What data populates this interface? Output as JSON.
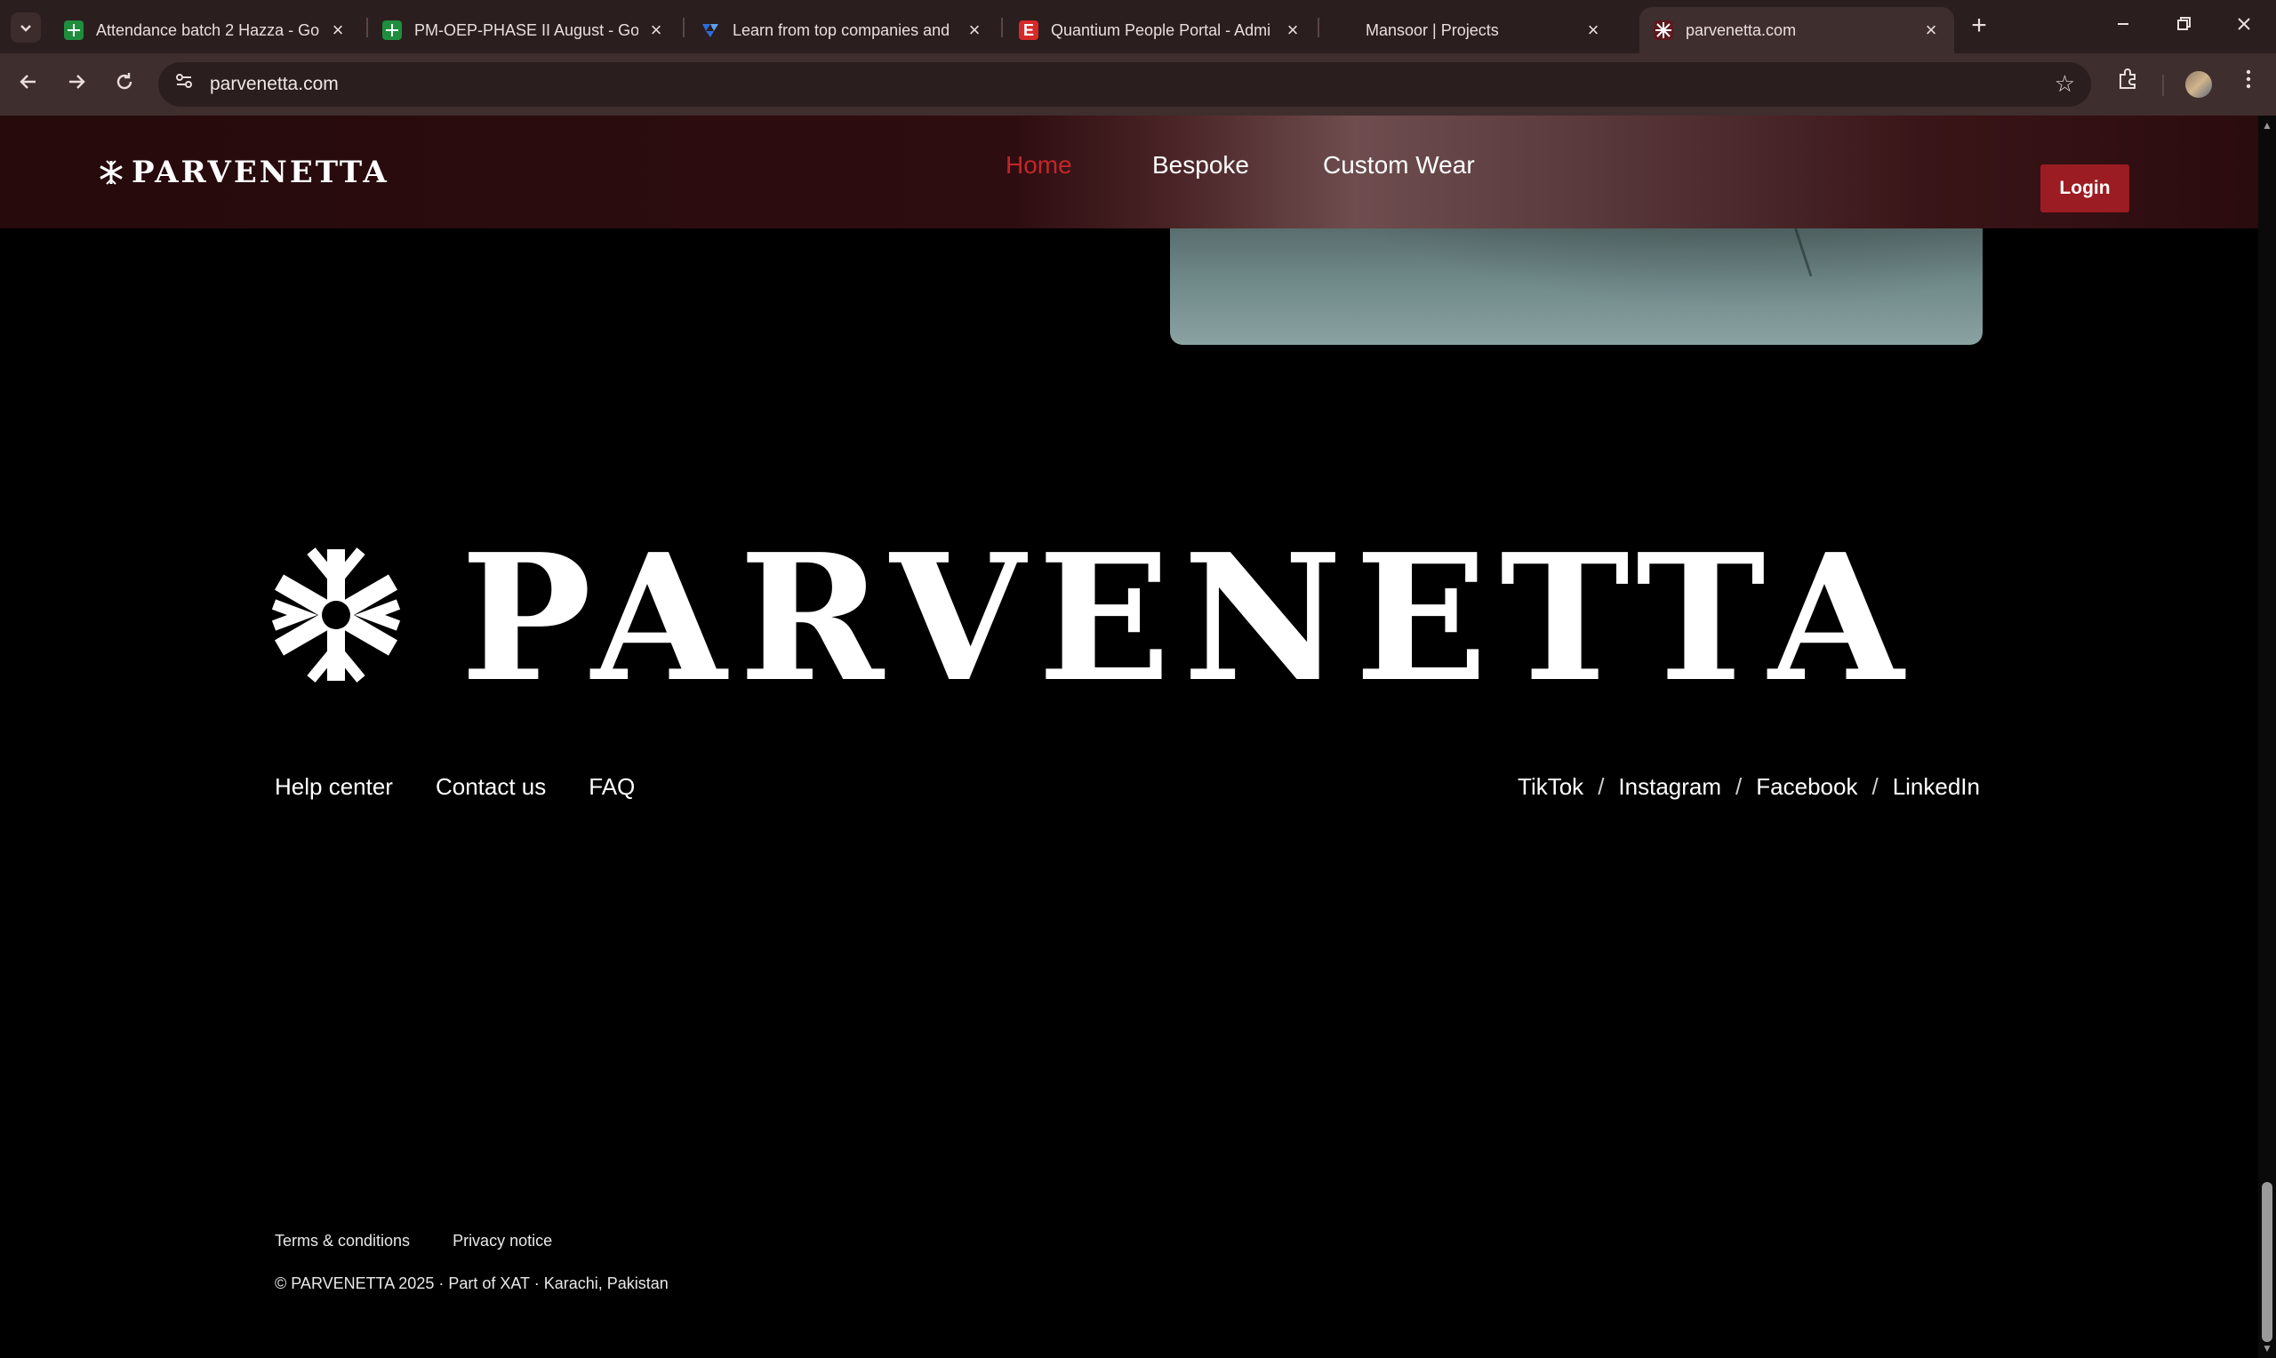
{
  "browser": {
    "tabs": [
      {
        "title": "Attendance batch 2 Hazza - Go",
        "favicon": "sheets-icon",
        "color": "#1e8e3e"
      },
      {
        "title": "PM-OEP-PHASE II August - Goo",
        "favicon": "sheets-icon",
        "color": "#1e8e3e"
      },
      {
        "title": "Learn from top companies and",
        "favicon": "brand-icon",
        "color": "#2e6bd9"
      },
      {
        "title": "Quantium People Portal - Admi",
        "favicon": "letter-e-icon",
        "color": "#d62a2a"
      },
      {
        "title": "Mansoor | Projects",
        "favicon": "none",
        "color": ""
      },
      {
        "title": "parvenetta.com",
        "favicon": "parvenetta-icon",
        "color": "#9b1c22"
      }
    ],
    "url": "parvenetta.com"
  },
  "site": {
    "brand": "PARVENETTA",
    "nav": [
      {
        "label": "Home",
        "active": true
      },
      {
        "label": "Bespoke",
        "active": false
      },
      {
        "label": "Custom Wear",
        "active": false
      }
    ],
    "login_label": "Login",
    "accent_color": "#c3262a",
    "button_color": "#9b1c22"
  },
  "footer": {
    "brand": "PARVENETTA",
    "links": [
      "Help center",
      "Contact us",
      "FAQ"
    ],
    "social": [
      "TikTok",
      "Instagram",
      "Facebook",
      "LinkedIn"
    ],
    "social_separator": "/",
    "legal": [
      "Terms & conditions",
      "Privacy notice"
    ],
    "copyright": "© PARVENETTA 2025 · Part of XAT · Karachi, Pakistan"
  }
}
